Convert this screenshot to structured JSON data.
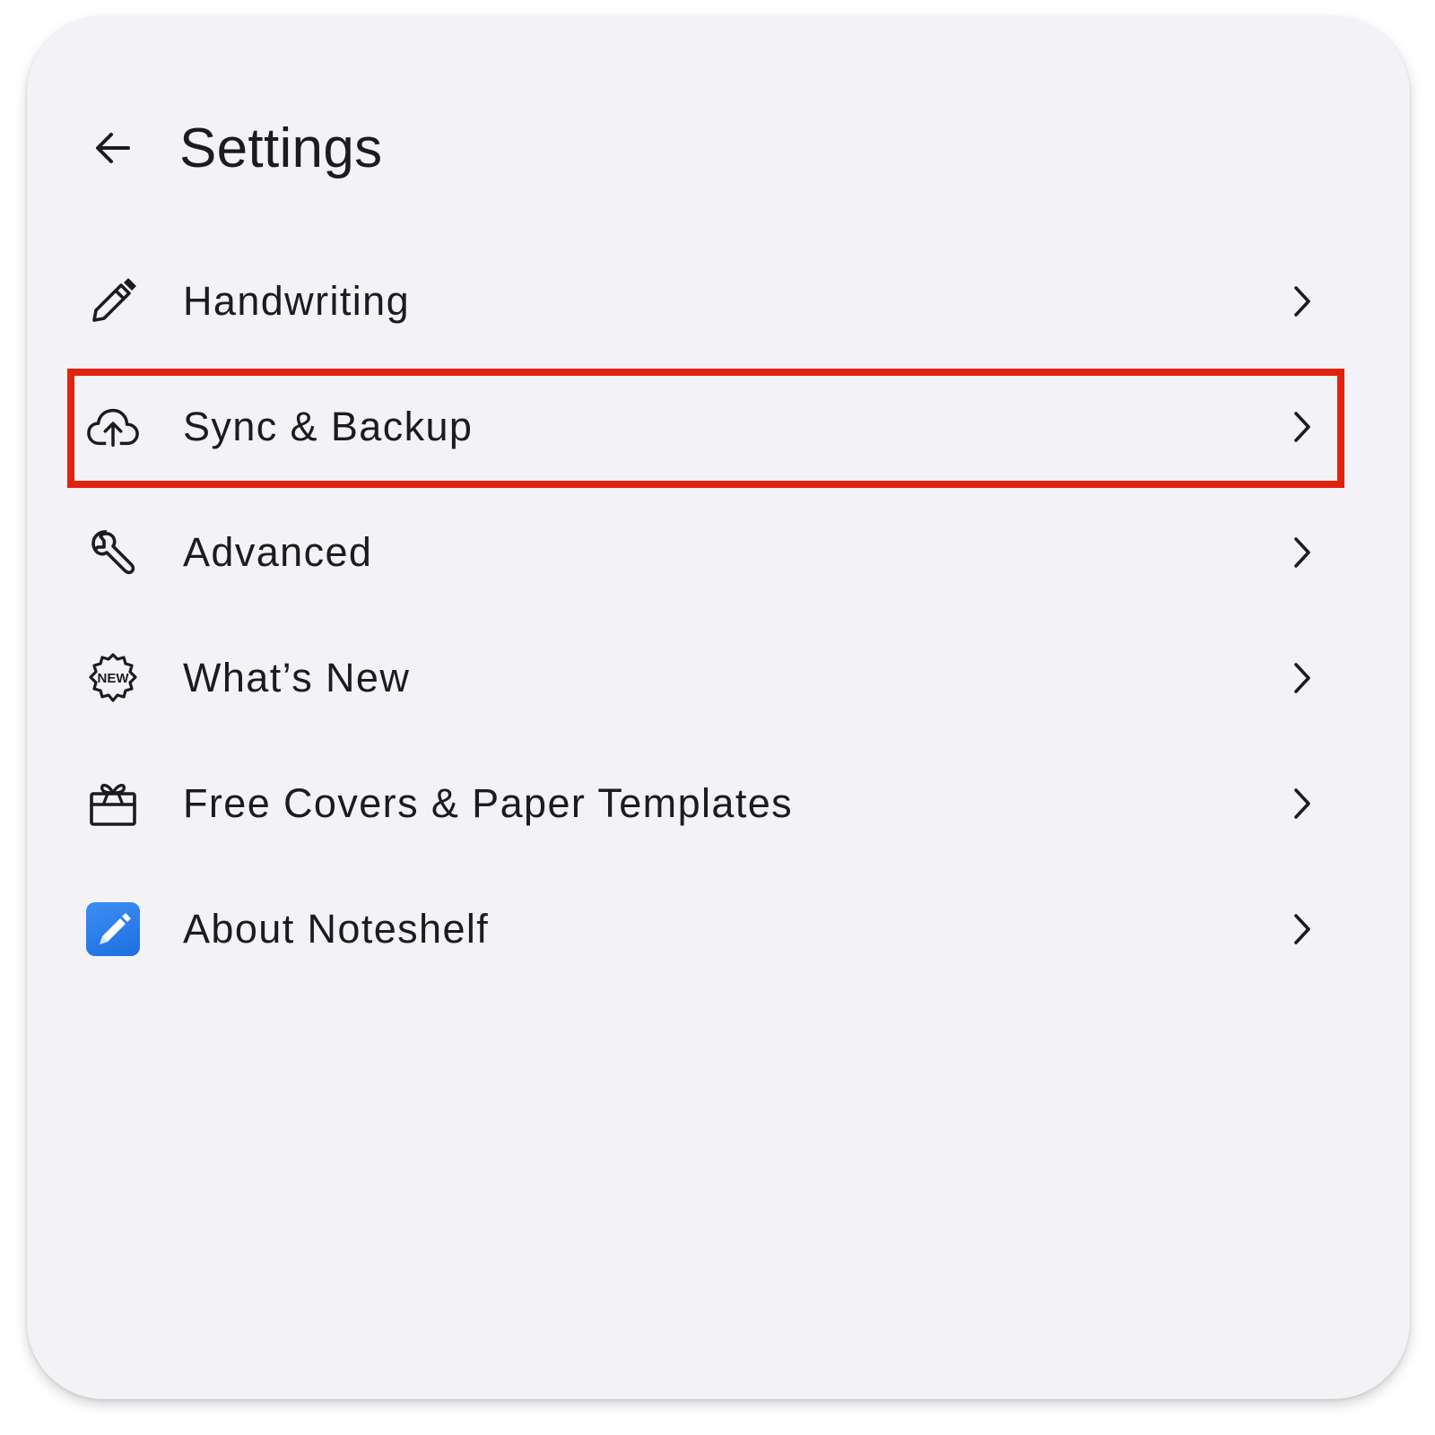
{
  "header": {
    "title": "Settings",
    "back_icon": "arrow-left-icon"
  },
  "menu": {
    "items": [
      {
        "label": "Handwriting",
        "icon": "pencil-icon"
      },
      {
        "label": "Sync & Backup",
        "icon": "cloud-upload-icon",
        "highlighted": true
      },
      {
        "label": "Advanced",
        "icon": "wrench-icon"
      },
      {
        "label": "What’s New",
        "icon": "new-badge-icon",
        "icon_text": "NEW"
      },
      {
        "label": "Free Covers & Paper Templates",
        "icon": "gift-box-icon"
      },
      {
        "label": "About Noteshelf",
        "icon": "noteshelf-app-icon"
      }
    ],
    "chevron_icon": "chevron-right-icon"
  },
  "colors": {
    "background": "#f3f2f7",
    "text": "#1c1b21",
    "highlight_border": "#e0230f",
    "app_icon_blue": "#2a7de9"
  }
}
